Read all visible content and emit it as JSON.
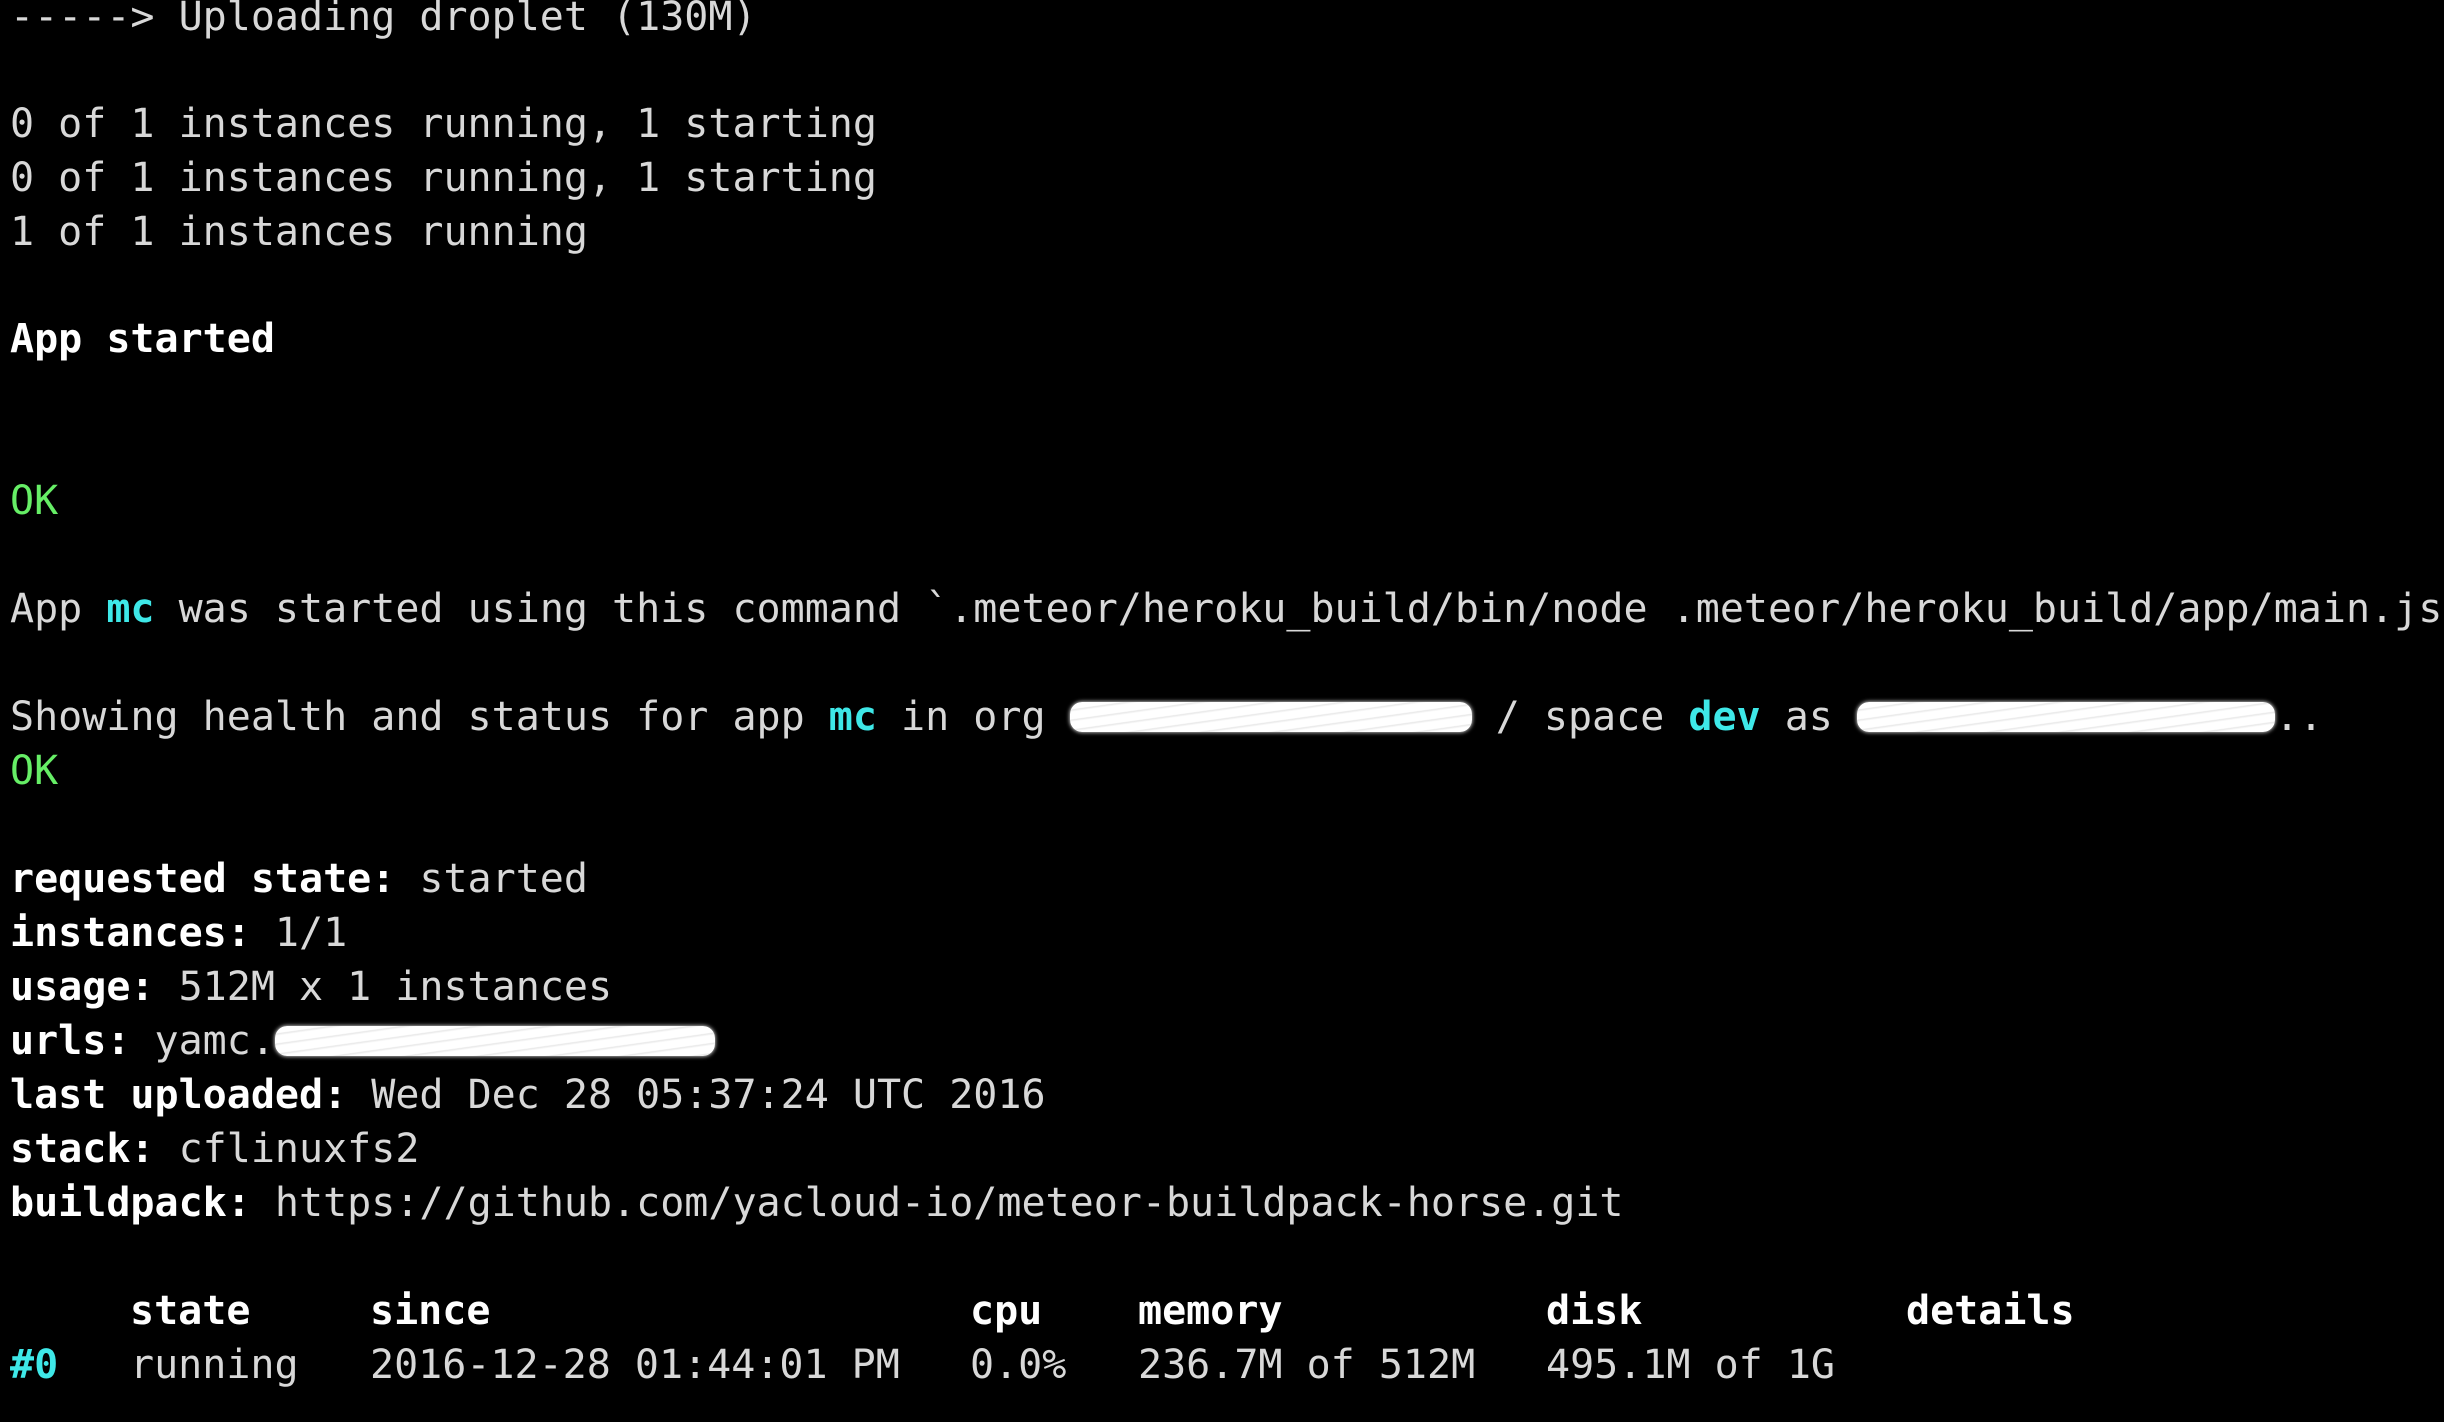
{
  "colors": {
    "background": "#000000",
    "text": "#d8d8d8",
    "ok": "#66ee66",
    "cyan": "#3ee8e8"
  },
  "log": {
    "uploading": "-----> Uploading droplet (130M)",
    "status1": "0 of 1 instances running, 1 starting",
    "status2": "0 of 1 instances running, 1 starting",
    "status3": "1 of 1 instances running",
    "app_started": "App started",
    "ok1": "OK",
    "cmd_prefix": "App ",
    "cmd_app": "mc",
    "cmd_suffix": " was started using this command `.meteor/heroku_build/bin/node .meteor/heroku_build/app/main.js",
    "show_prefix": "Showing health and status for app ",
    "show_app": "mc",
    "show_in_org": " in org ",
    "show_space": " / space ",
    "show_space_name": "dev",
    "show_as": " as ",
    "show_dots": "..",
    "ok2": "OK"
  },
  "details": {
    "requested_state_label": "requested state:",
    "requested_state_value": " started",
    "instances_label": "instances:",
    "instances_value": " 1/1",
    "usage_label": "usage:",
    "usage_value": " 512M x 1 instances",
    "urls_label": "urls:",
    "urls_value": " yamc.",
    "last_uploaded_label": "last uploaded:",
    "last_uploaded_value": " Wed Dec 28 05:37:24 UTC 2016",
    "stack_label": "stack:",
    "stack_value": " cflinuxfs2",
    "buildpack_label": "buildpack:",
    "buildpack_value": " https://github.com/yacloud-io/meteor-buildpack-horse.git"
  },
  "table": {
    "headers": {
      "state": "state",
      "since": "since",
      "cpu": "cpu",
      "memory": "memory",
      "disk": "disk",
      "details": "details"
    },
    "rows": [
      {
        "index": "#0",
        "state": "running",
        "since": "2016-12-28 01:44:01 PM",
        "cpu": "0.0%",
        "memory": "236.7M of 512M",
        "disk": "495.1M of 1G",
        "details": ""
      }
    ]
  }
}
